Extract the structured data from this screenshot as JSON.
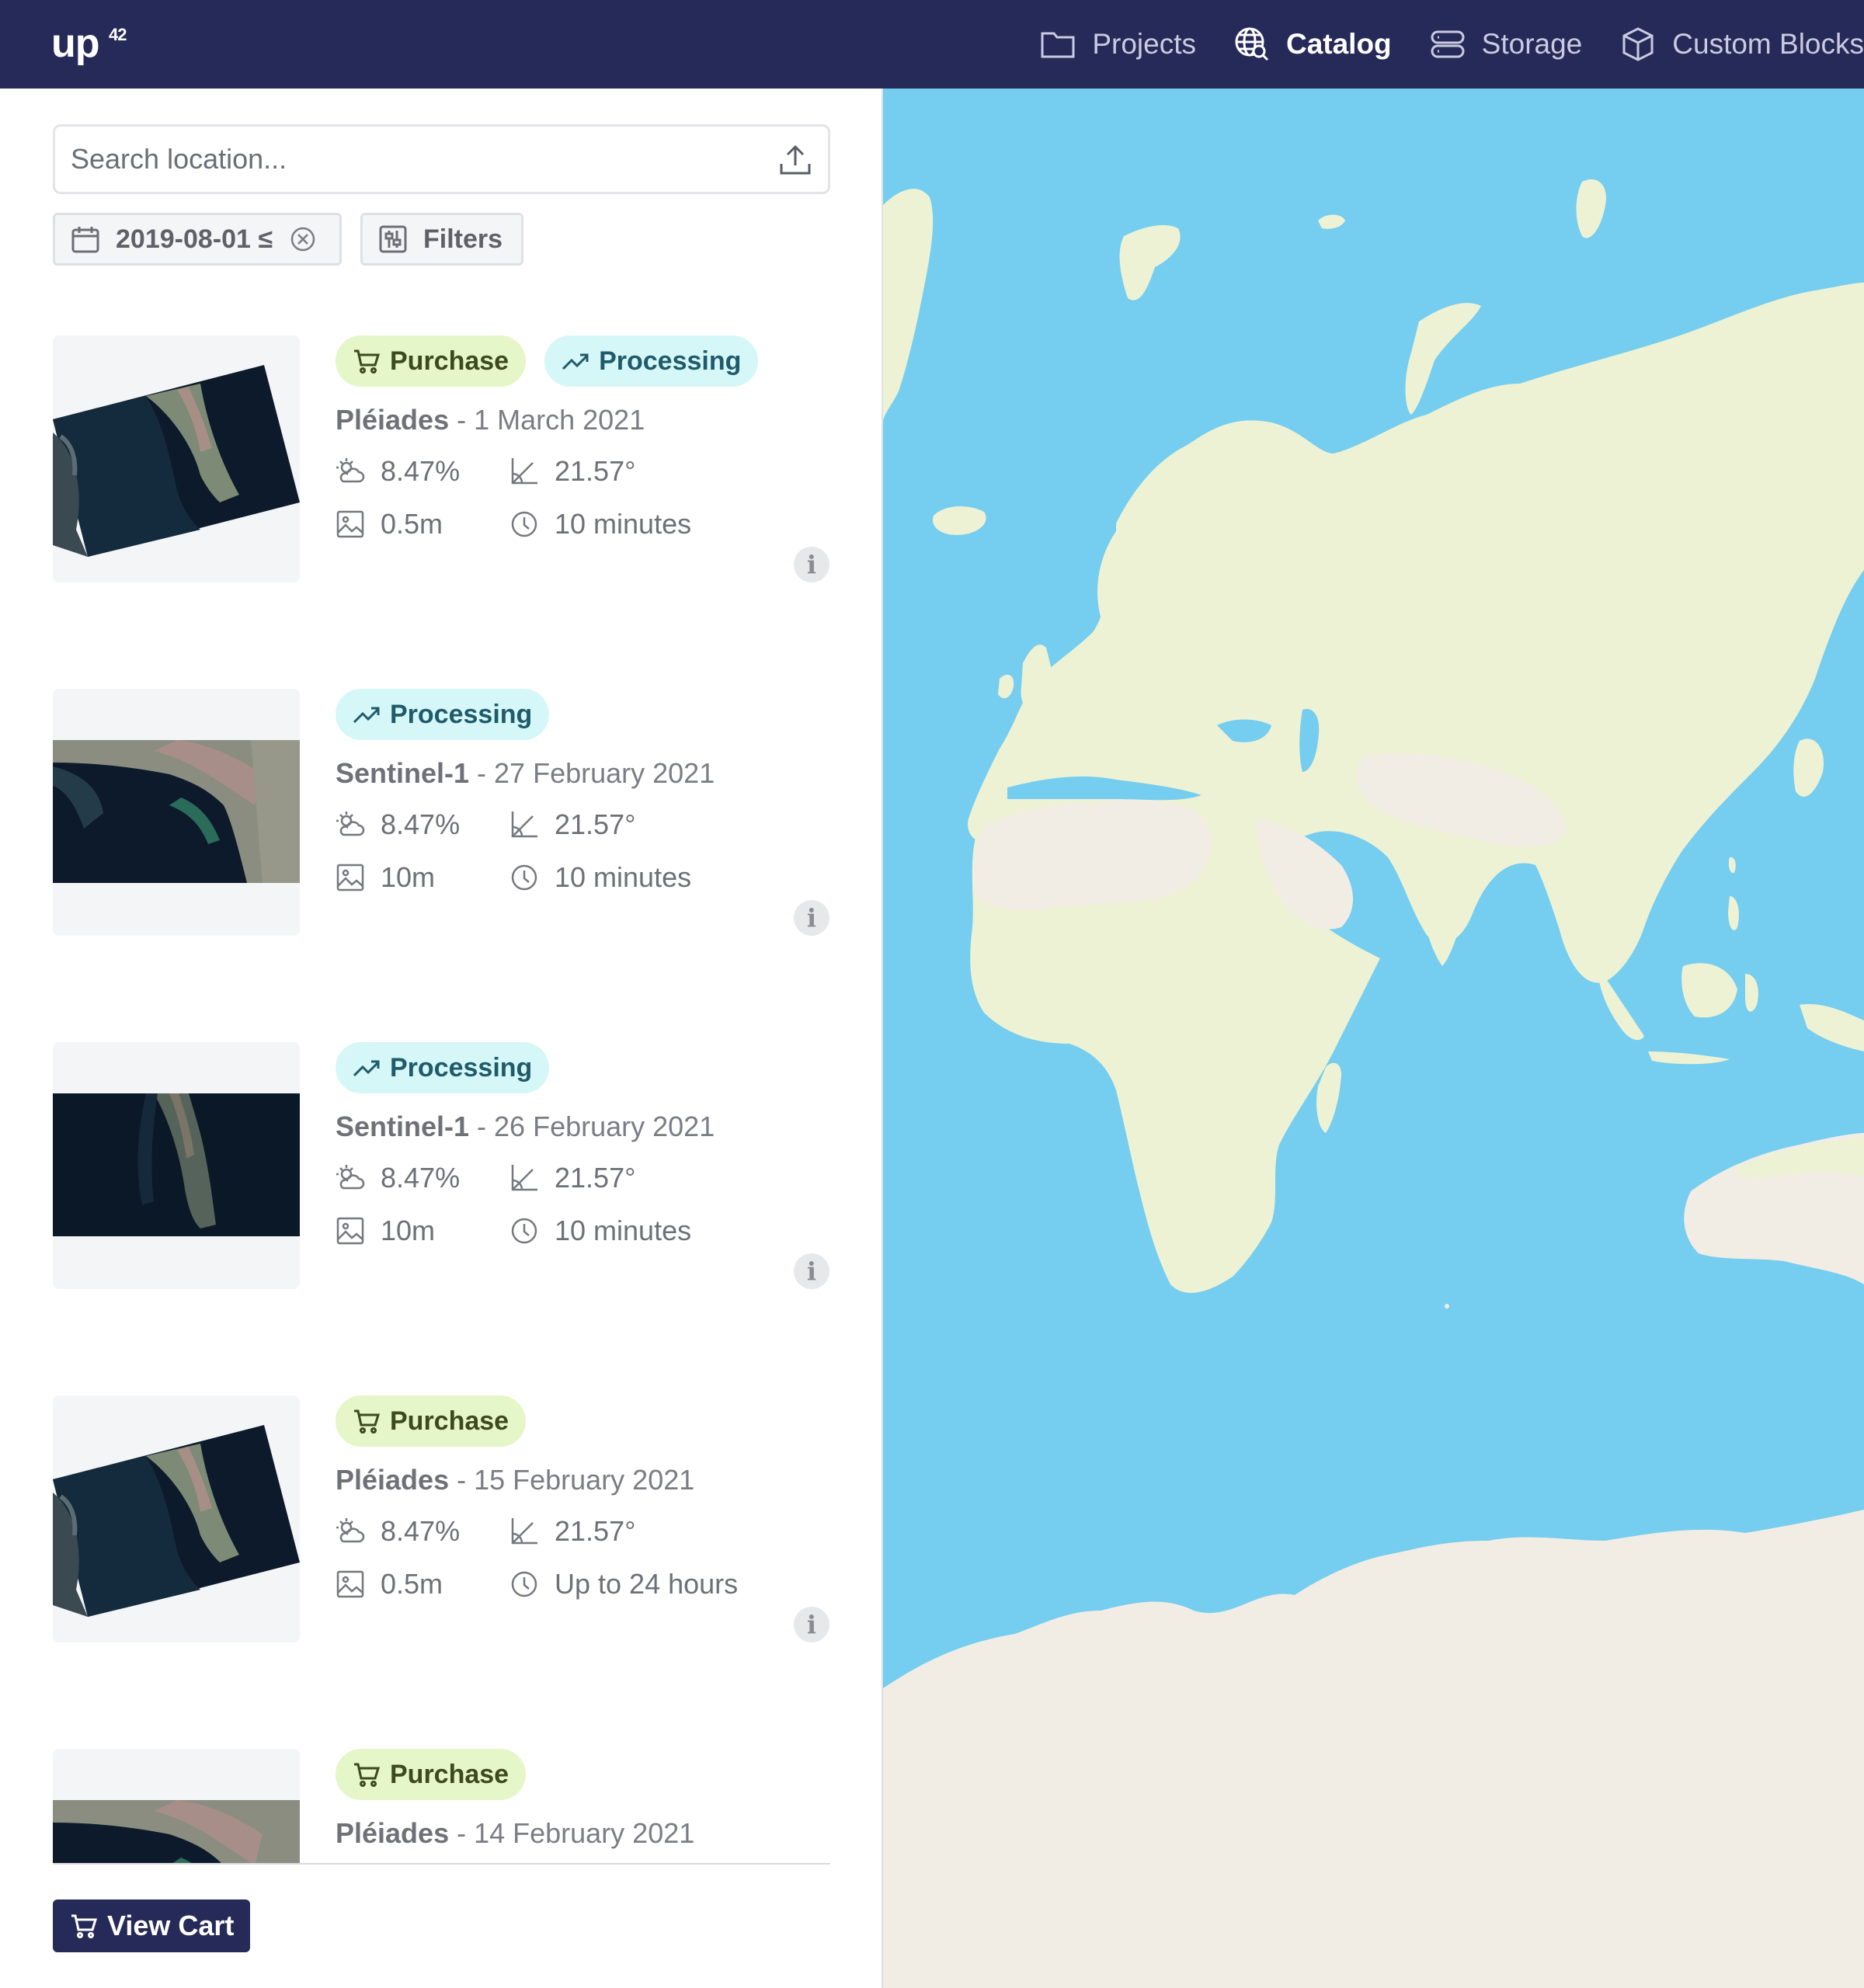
{
  "header": {
    "logo": "up",
    "logo_superscript": "42",
    "nav": [
      {
        "label": "Projects",
        "icon": "folder-icon",
        "active": false
      },
      {
        "label": "Catalog",
        "icon": "globe-search-icon",
        "active": true
      },
      {
        "label": "Storage",
        "icon": "storage-icon",
        "active": false
      },
      {
        "label": "Custom Blocks",
        "icon": "cube-icon",
        "active": false
      }
    ]
  },
  "search": {
    "placeholder": "Search location...",
    "upload_icon": "upload-icon"
  },
  "filters": {
    "date_chip": "2019-08-01 ≤",
    "filters_label": "Filters"
  },
  "results": [
    {
      "tags": [
        "Purchase",
        "Processing"
      ],
      "sensor": "Pléiades",
      "date": " - 1 March 2021",
      "cloud": "8.47%",
      "angle": "21.57°",
      "resolution": "0.5m",
      "delivery": "10 minutes"
    },
    {
      "tags": [
        "Processing"
      ],
      "sensor": "Sentinel-1",
      "date": " - 27 February 2021",
      "cloud": "8.47%",
      "angle": "21.57°",
      "resolution": "10m",
      "delivery": "10 minutes"
    },
    {
      "tags": [
        "Processing"
      ],
      "sensor": "Sentinel-1",
      "date": " - 26 February 2021",
      "cloud": "8.47%",
      "angle": "21.57°",
      "resolution": "10m",
      "delivery": "10 minutes"
    },
    {
      "tags": [
        "Purchase"
      ],
      "sensor": "Pléiades",
      "date": " - 15 February 2021",
      "cloud": "8.47%",
      "angle": "21.57°",
      "resolution": "0.5m",
      "delivery": "Up to 24 hours"
    },
    {
      "tags": [
        "Purchase"
      ],
      "sensor": "Pléiades",
      "date": " - 14 February 2021"
    }
  ],
  "info_glyph": "i",
  "cart": {
    "label": "View Cart"
  },
  "colors": {
    "header_bg": "#262a58",
    "purchase_tag_bg": "#e5f6c8",
    "processing_tag_bg": "#d6f7f7",
    "ocean": "#75cdef",
    "land": "#eef2d4",
    "desert": "#f1ede4"
  }
}
